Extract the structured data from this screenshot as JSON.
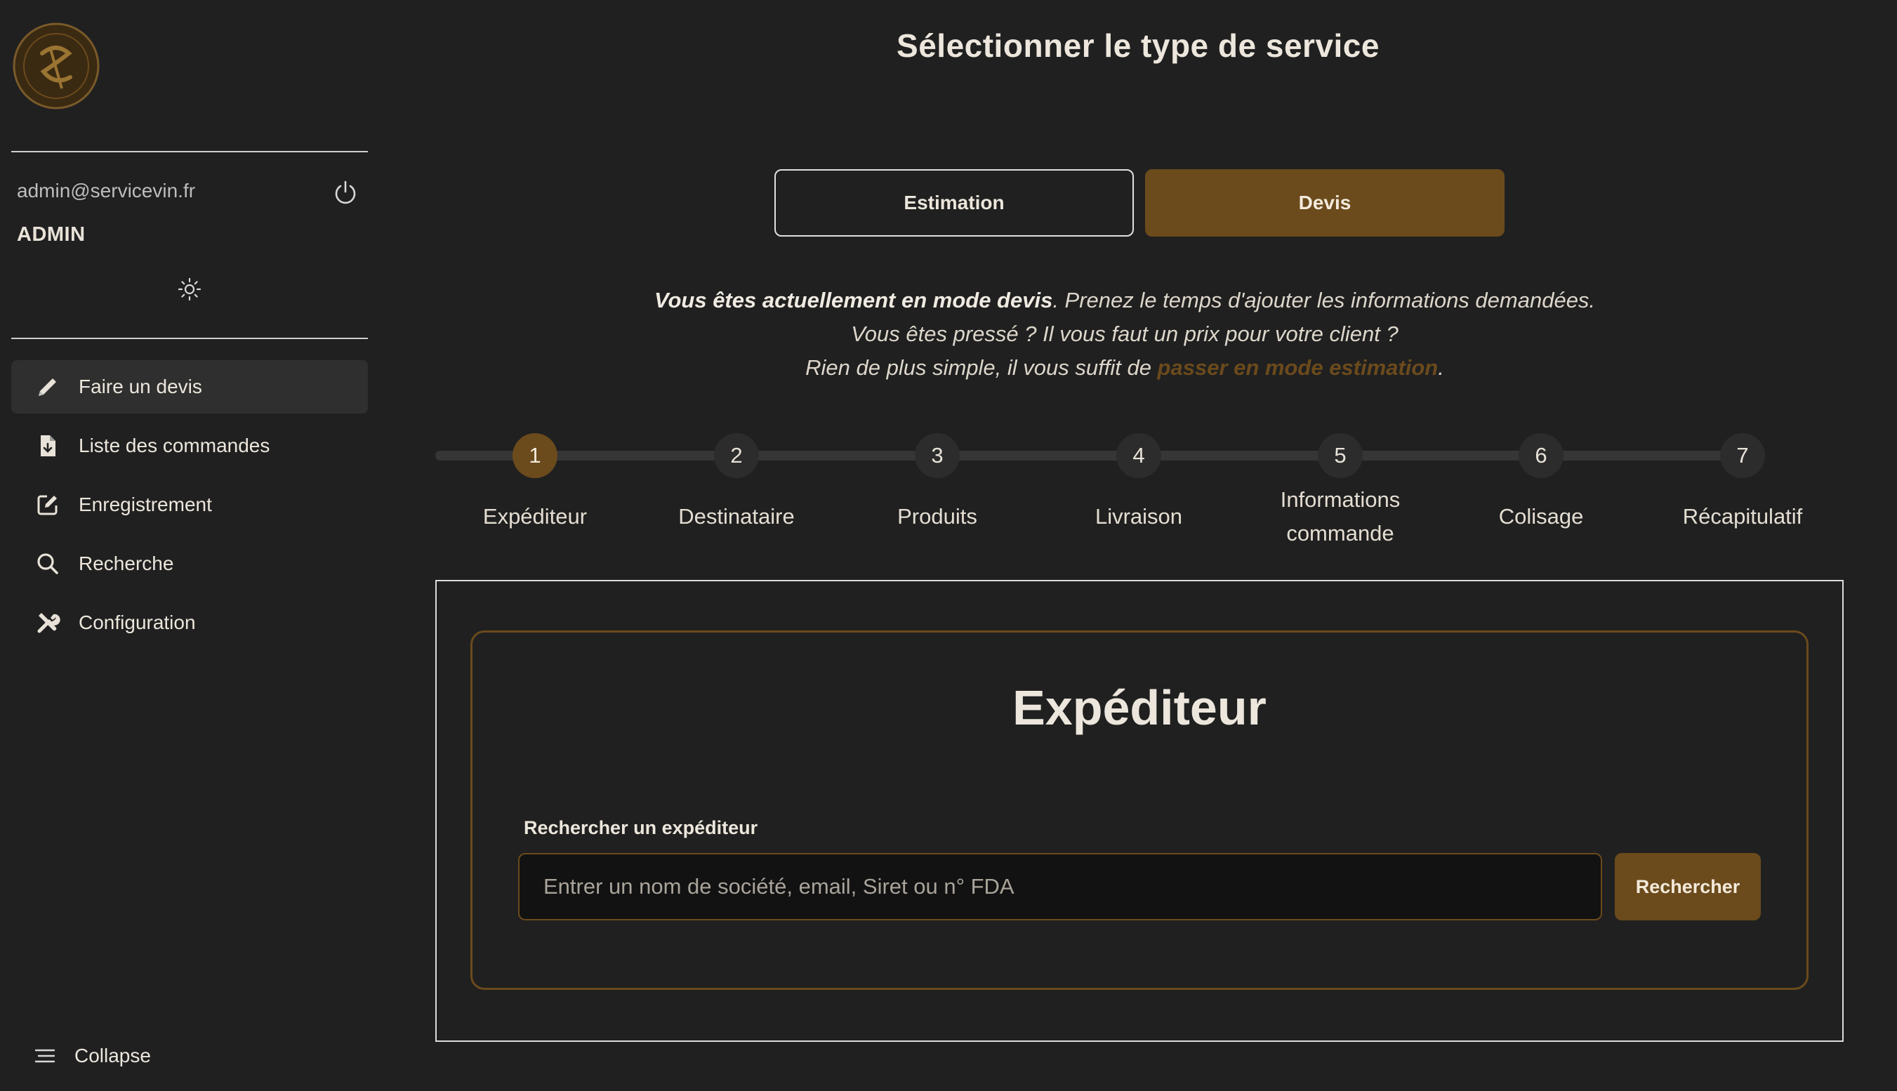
{
  "sidebar": {
    "user_email": "admin@servicevin.fr",
    "user_role": "ADMIN",
    "nav": [
      {
        "label": "Faire un devis",
        "icon": "pencil-icon",
        "active": true
      },
      {
        "label": "Liste des commandes",
        "icon": "file-download-icon",
        "active": false
      },
      {
        "label": "Enregistrement",
        "icon": "edit-square-icon",
        "active": false
      },
      {
        "label": "Recherche",
        "icon": "search-icon",
        "active": false
      },
      {
        "label": "Configuration",
        "icon": "tools-icon",
        "active": false
      }
    ],
    "collapse_label": "Collapse"
  },
  "main": {
    "title": "Sélectionner le type de service",
    "service_buttons": {
      "estimation": "Estimation",
      "devis": "Devis"
    },
    "selected_service": "Devis",
    "info": {
      "line1_strong": "Vous êtes actuellement en mode devis",
      "line1_rest": ". Prenez le temps d'ajouter les informations demandées.",
      "line2": "Vous êtes pressé ? Il vous faut un prix pour votre client ?",
      "line3_prefix": "Rien de plus simple, il vous suffit de ",
      "line3_link": "passer en mode estimation",
      "line3_suffix": "."
    },
    "steps": [
      {
        "number": "1",
        "label": "Expéditeur"
      },
      {
        "number": "2",
        "label": "Destinataire"
      },
      {
        "number": "3",
        "label": "Produits"
      },
      {
        "number": "4",
        "label": "Livraison"
      },
      {
        "number": "5",
        "label": "Informations commande"
      },
      {
        "number": "6",
        "label": "Colisage"
      },
      {
        "number": "7",
        "label": "Récapitulatif"
      }
    ],
    "active_step": 1,
    "panel": {
      "title": "Expéditeur",
      "search_label": "Rechercher un expéditeur",
      "search_placeholder": "Entrer un nom de société, email, Siret ou n° FDA",
      "search_value": "",
      "search_button": "Rechercher"
    }
  },
  "colors": {
    "background": "#202020",
    "accent": "#6b4a1c",
    "text": "#ece6dc"
  }
}
